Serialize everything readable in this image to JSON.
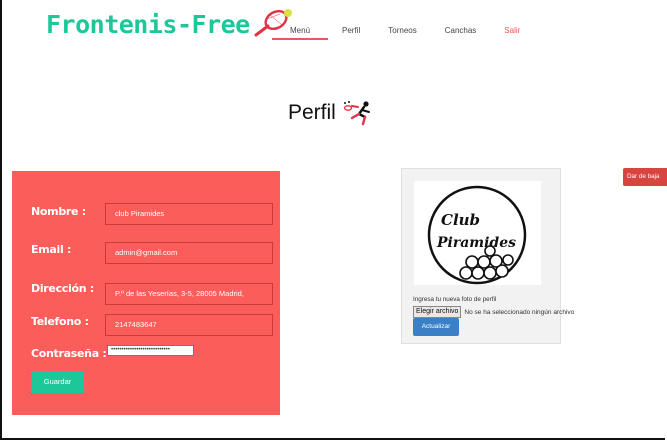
{
  "header": {
    "logo_text": "Frontenis-Free",
    "nav": [
      {
        "label": "Menú"
      },
      {
        "label": "Perfil"
      },
      {
        "label": "Torneos"
      },
      {
        "label": "Canchas"
      },
      {
        "label": "Salir"
      }
    ],
    "active_color": "#e85a5a",
    "accent_color": "#1ec79a"
  },
  "page": {
    "title": "Perfil",
    "title_icon": "tennis-player-icon"
  },
  "form": {
    "fields": [
      {
        "label": "Nombre :",
        "value": "club Piramides"
      },
      {
        "label": "Email :",
        "value": "admin@gmail.com"
      },
      {
        "label": "Dirección :",
        "value": "P.º de las Yeserías, 3-5, 28005 Madrid,"
      },
      {
        "label": "Telefono :",
        "value": "2147483647"
      }
    ],
    "password_label": "Contraseña :",
    "password_value": "••••••••••••••••••••••••••••",
    "save_label": "Guardar",
    "panel_color": "#fb5d5b"
  },
  "photo": {
    "club_line1": "Club",
    "club_line2": "Piramides",
    "upload_label": "Ingresa tu nueva foto de perfil",
    "file_button": "Elegir archivo",
    "file_status": "No se ha seleccionado ningún archivo",
    "update_label": "Actualizar"
  },
  "account": {
    "delete_label": "Dar de baja"
  }
}
